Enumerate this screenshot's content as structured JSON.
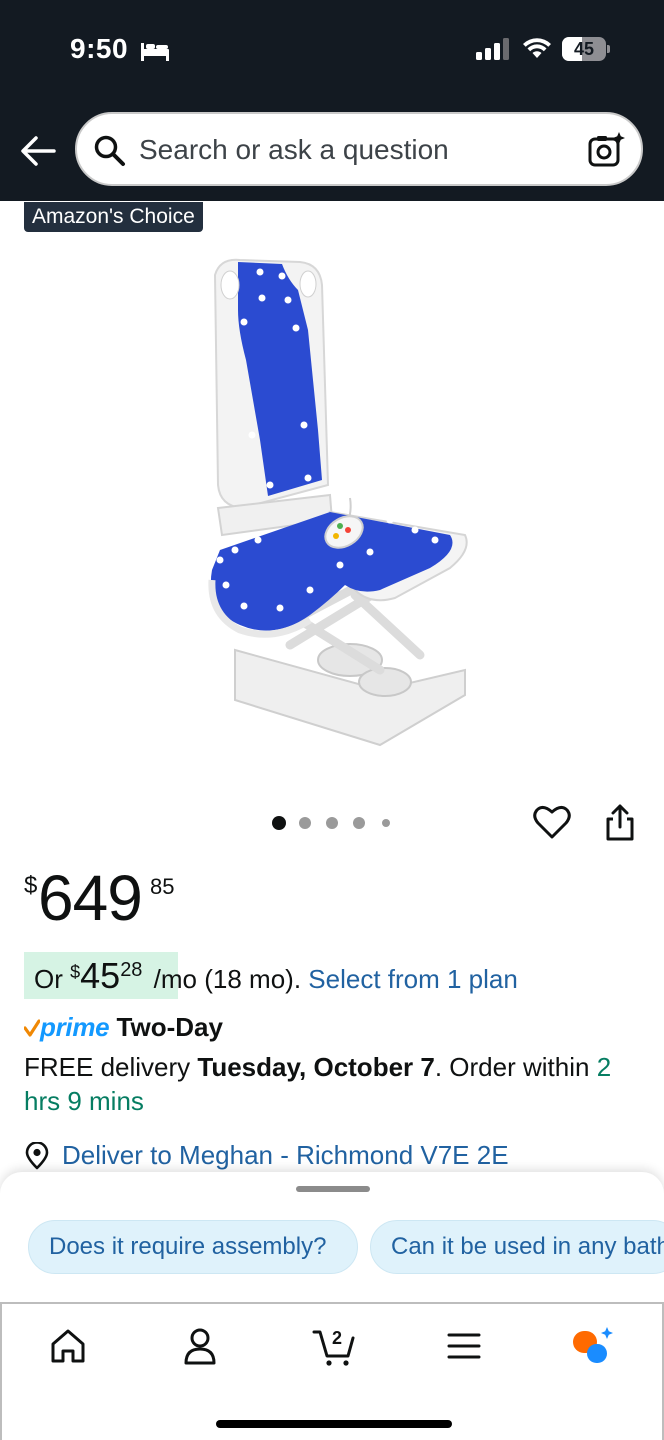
{
  "status_bar": {
    "time": "9:50",
    "battery": "45"
  },
  "header": {
    "search_placeholder": "Search or ask a question"
  },
  "product": {
    "badge": "Amazon's Choice",
    "image_count": 5,
    "active_image": 1,
    "price": {
      "currency_symbol": "$",
      "whole": "649",
      "fraction": "85"
    },
    "monthly": {
      "prefix": "Or",
      "currency_symbol": "$",
      "whole": "45",
      "fraction": "28",
      "term": "/mo (18 mo).",
      "link": "Select from 1 plan"
    },
    "prime": {
      "brand": "prime",
      "label": "Two-Day"
    },
    "delivery": {
      "prefix": "FREE delivery",
      "date": "Tuesday, October 7",
      "order_within_prefix": ". Order within",
      "countdown": "2 hrs 9 mins"
    },
    "deliver_to": "Deliver to Meghan - Richmond V7E 2E"
  },
  "suggestions": [
    "Does it require assembly?",
    "Can it be used in any bathtub?"
  ],
  "bottom_nav": {
    "cart_count": "2",
    "items": [
      "home-icon",
      "account-icon",
      "cart-icon",
      "menu-icon",
      "rufus-icon"
    ]
  },
  "colors": {
    "header_bg": "#131a22",
    "link": "#2162a1",
    "prime_blue": "#1399ff",
    "prime_check": "#f08804",
    "green": "#067d62",
    "monthly_bg": "#d6f3e4",
    "chip_bg": "#dff2fb",
    "seat_blue": "#2b4bd1"
  }
}
